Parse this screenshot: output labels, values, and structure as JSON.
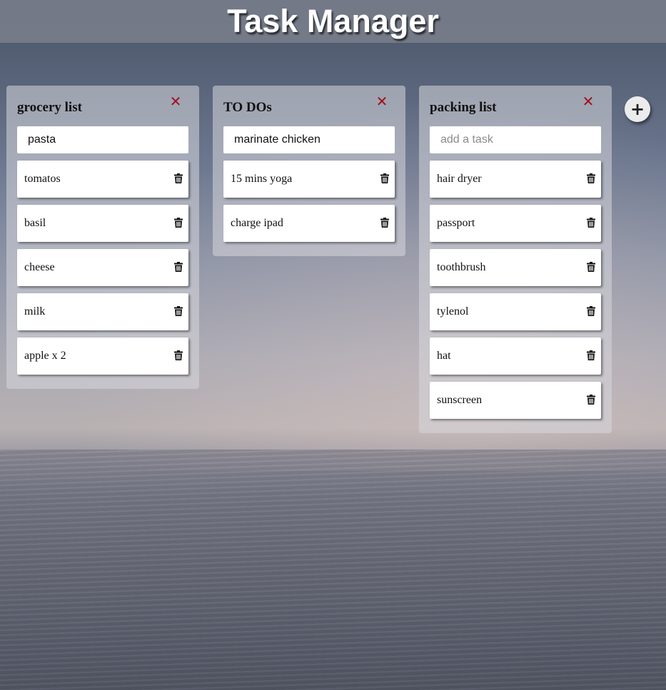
{
  "app": {
    "title": "Task Manager"
  },
  "lists": [
    {
      "title": "grocery list",
      "close_icon": "close-icon",
      "input": {
        "value": "pasta",
        "placeholder": "add a task"
      },
      "tasks": [
        "tomatos",
        "basil",
        "cheese",
        "milk",
        "apple x 2"
      ]
    },
    {
      "title": "TO DOs",
      "close_icon": "close-icon",
      "input": {
        "value": "marinate chicken",
        "placeholder": "add a task"
      },
      "tasks": [
        "15 mins yoga",
        "charge ipad"
      ]
    },
    {
      "title": "packing list",
      "close_icon": "close-icon",
      "input": {
        "value": "",
        "placeholder": "add a task"
      },
      "tasks": [
        "hair dryer",
        "passport",
        "toothbrush",
        "tylenol",
        "hat",
        "sunscreen"
      ]
    }
  ],
  "add_list_button": {
    "label": "+",
    "icon": "plus-icon"
  },
  "icons": {
    "delete": "trash-icon",
    "close": "close-icon"
  },
  "colors": {
    "close_icon": "#a0101a",
    "title_text": "#ffffff",
    "header_bar": "#787d8a"
  }
}
